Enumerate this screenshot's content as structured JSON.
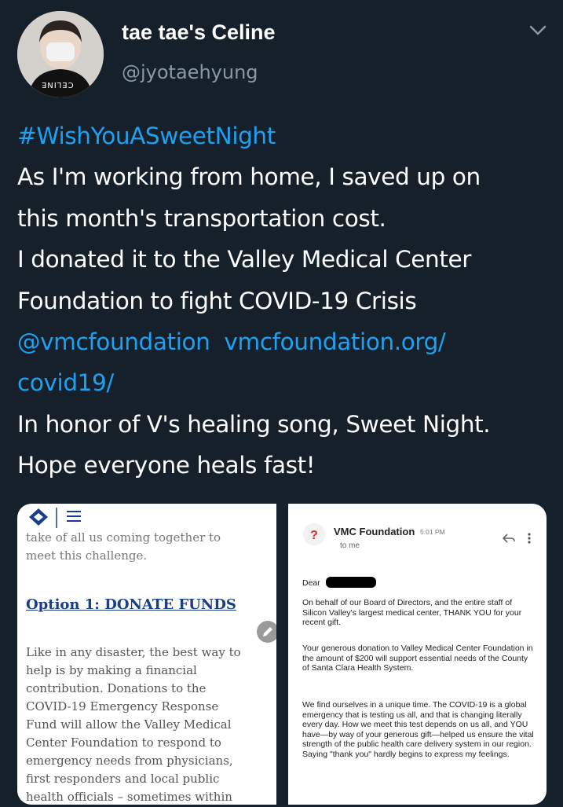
{
  "author": {
    "display_name": "tae tae's Celine",
    "handle": "@jyotaehyung",
    "avatar_shirt_text": "CELINE"
  },
  "tweet": {
    "hashtag": "#WishYouASweetNight",
    "line1": "As I'm working from home, I saved up on",
    "line2": "this month's transportation cost.",
    "line3": "I donated it to the Valley Medical Center",
    "line4": "Foundation to fight COVID-19 Crisis",
    "mention": "@vmcfoundation",
    "url_part1": "vmcfoundation.org/",
    "url_part2": "covid19/",
    "line8": "In honor of V's healing song, Sweet Night.",
    "line9": "Hope everyone heals fast!"
  },
  "media": {
    "left": {
      "top_text_1": "take of all us coming together to",
      "top_text_2": "meet this challenge.",
      "heading": "Option 1: DONATE FUNDS",
      "body": [
        "Like in any disaster, the best way to",
        "help is by making a financial",
        "contribution.  Donations to the",
        "COVID-19 Emergency Response",
        "Fund will allow the Valley Medical",
        "Center Foundation to respond to",
        "emergency needs from physicians,",
        "first responders and local public",
        "health officials – sometimes within"
      ]
    },
    "right": {
      "sender": "VMC Foundation",
      "time": "5:01 PM",
      "to": "to me",
      "greeting": "Dear",
      "p1": "On behalf of our Board of Directors, and the entire staff of Silicon Valley's largest medical center, THANK YOU for your recent gift.",
      "p2": "Your generous donation to Valley Medical Center Foundation in the amount of $200 will support essential needs of the County of Santa Clara Health System.",
      "p3": "We find ourselves in a  unique time. The COVID-19 is a global emergency that is testing us all, and that is changing literally every day. How we meet this test depends on us all, and YOU have—by way of your generous gift—helped us ensure the vital strength of the public health care delivery system in our region. Saying \"thank you\" hardly begins to express my feelings."
    }
  },
  "colors": {
    "background": "#15202b",
    "link": "#1da1f2",
    "secondary_text": "#8899a6"
  },
  "icons": [
    "chevron-down-icon",
    "mail-unknown-sender-icon",
    "reply-icon",
    "more-vertical-icon",
    "menu-icon",
    "edit-pencil-icon",
    "logo-diamond-icon"
  ]
}
